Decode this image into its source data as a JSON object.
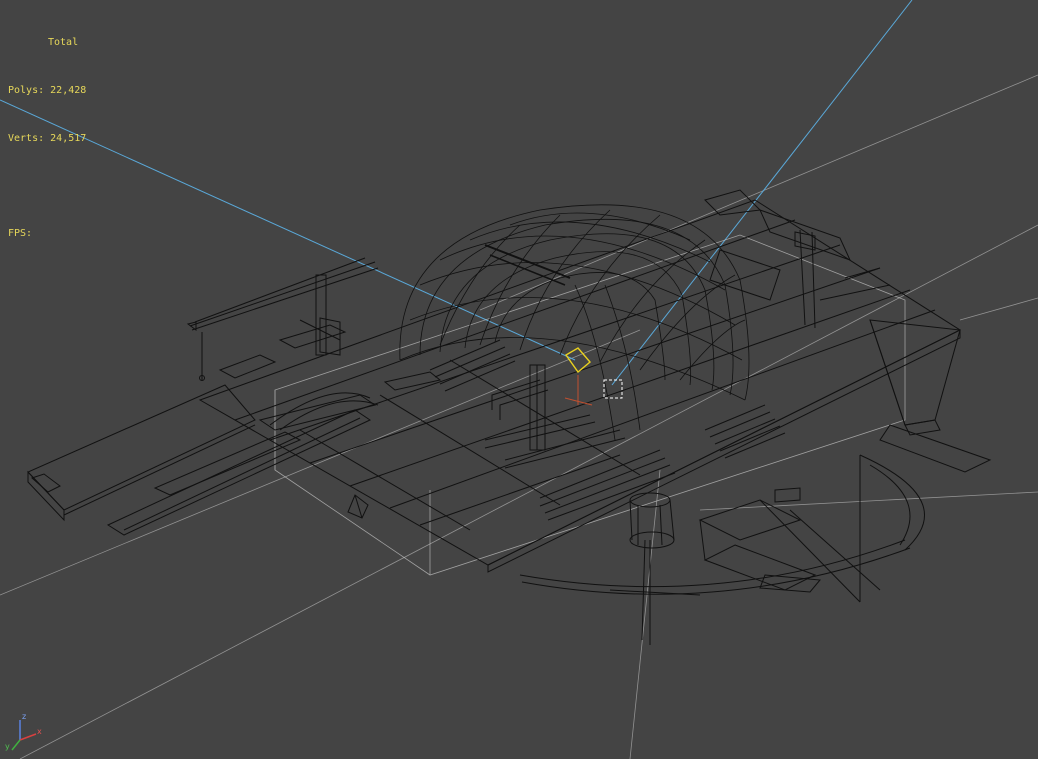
{
  "stats": {
    "total_label": "Total",
    "polys_label": "Polys:",
    "polys_value": "22,428",
    "verts_label": "Verts:",
    "verts_value": "24,517",
    "fps_label": "FPS:"
  },
  "axis": {
    "x": "x",
    "y": "y",
    "z": "z"
  },
  "colors": {
    "background": "#444444",
    "stats_text": "#e6d75a",
    "light_line": "#5aa8d8",
    "wire": "#111111",
    "grid": "#9a9a9a",
    "selected": "#e8d020"
  }
}
